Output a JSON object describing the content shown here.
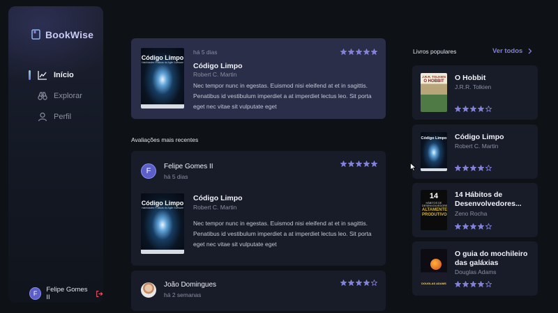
{
  "app": {
    "name": "BookWise"
  },
  "sidebar": {
    "items": [
      {
        "label": "Início",
        "icon": "chart-line-icon",
        "active": true
      },
      {
        "label": "Explorar",
        "icon": "binoculars-icon",
        "active": false
      },
      {
        "label": "Perfil",
        "icon": "user-icon",
        "active": false
      }
    ],
    "user": {
      "initial": "F",
      "name": "Felipe Gomes II"
    }
  },
  "last_read": {
    "time": "há 5 dias",
    "book": {
      "title": "Código Limpo",
      "author": "Robert C. Martin",
      "cover_title": "Código Limpo",
      "cover_subtitle": "Habilidades Práticas do Agile Software"
    },
    "rating": 5,
    "description": "Nec tempor nunc in egestas. Euismod nisi eleifend at et in sagittis. Penatibus id vestibulum imperdiet a at imperdiet lectus leo. Sit porta eget nec vitae sit vulputate eget"
  },
  "recent": {
    "heading": "Avaliações mais recentes",
    "reviews": [
      {
        "user": "Felipe Gomes II",
        "initial": "F",
        "time": "há 5 dias",
        "rating": 5,
        "book": {
          "title": "Código Limpo",
          "author": "Robert C. Martin",
          "cover_title": "Código Limpo",
          "cover_subtitle": "Habilidades Práticas do Agile Software"
        },
        "description": "Nec tempor nunc in egestas. Euismod nisi eleifend at et in sagittis. Penatibus id vestibulum imperdiet a at imperdiet lectus leo. Sit porta eget nec vitae sit vulputate eget"
      },
      {
        "user": "João Domingues",
        "time": "há 2 semanas",
        "rating": 4
      }
    ]
  },
  "popular": {
    "heading": "Livros populares",
    "see_all": "Ver todos",
    "books": [
      {
        "title": "O Hobbit",
        "author": "J.R.R. Tolkien",
        "rating": 4,
        "cover_text": "J.R.R. TOLKIEN",
        "cover_text2": "O HOBBIT"
      },
      {
        "title": "Código Limpo",
        "author": "Robert C. Martin",
        "rating": 4,
        "cover_text": "Código Limpo"
      },
      {
        "title": "14 Hábitos de Desenvolvedores...",
        "author": "Zeno Rocha",
        "rating": 4,
        "cover_text": "14",
        "cover_text2": "HÁBITOS DE DESENVOLVEDORES",
        "cover_text3": "ALTAMENTE PRODUTIVOS"
      },
      {
        "title": "O guia do mochileiro das galáxias",
        "author": "Douglas Adams",
        "rating": 4,
        "cover_text": "DOUGLAS ADAMS"
      }
    ]
  },
  "colors": {
    "accent": "#8381d9",
    "background": "#0e1116",
    "card": "#181c29",
    "highlight_card": "#2a2e48"
  }
}
